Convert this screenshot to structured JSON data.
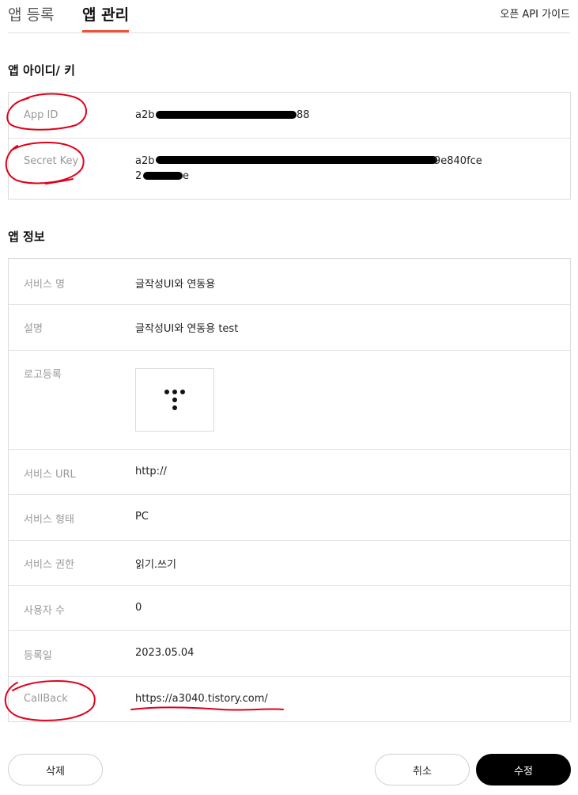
{
  "tabs": {
    "register": "앱 등록",
    "manage": "앱 관리",
    "guide_link": "오픈 API 가이드"
  },
  "app_keys": {
    "title": "앱 아이디/ 키",
    "app_id_label": "App ID",
    "app_id_prefix": "a2b",
    "app_id_suffix": "88",
    "secret_key_label": "Secret Key",
    "secret_key_line1_prefix": "a2b",
    "secret_key_line1_suffix": "9e840fce",
    "secret_key_line2_prefix": "2",
    "secret_key_line2_suffix": "e"
  },
  "app_info": {
    "title": "앱 정보",
    "rows": [
      {
        "label": "서비스 명",
        "value": "글작성UI와 연동용"
      },
      {
        "label": "설명",
        "value": "글작성UI와 연동용 test"
      },
      {
        "label": "로고등록",
        "value": ""
      },
      {
        "label": "서비스 URL",
        "value": "http://"
      },
      {
        "label": "서비스 형태",
        "value": "PC"
      },
      {
        "label": "서비스 권한",
        "value": "읽기.쓰기"
      },
      {
        "label": "사용자 수",
        "value": "0"
      },
      {
        "label": "등록일",
        "value": "2023.05.04"
      },
      {
        "label": "CallBack",
        "value": "https://a3040.tistory.com/"
      }
    ]
  },
  "buttons": {
    "delete": "삭제",
    "cancel": "취소",
    "edit": "수정"
  },
  "colors": {
    "accent": "#f0513b",
    "annotation": "#e0001a",
    "primary_button": "#000000"
  }
}
